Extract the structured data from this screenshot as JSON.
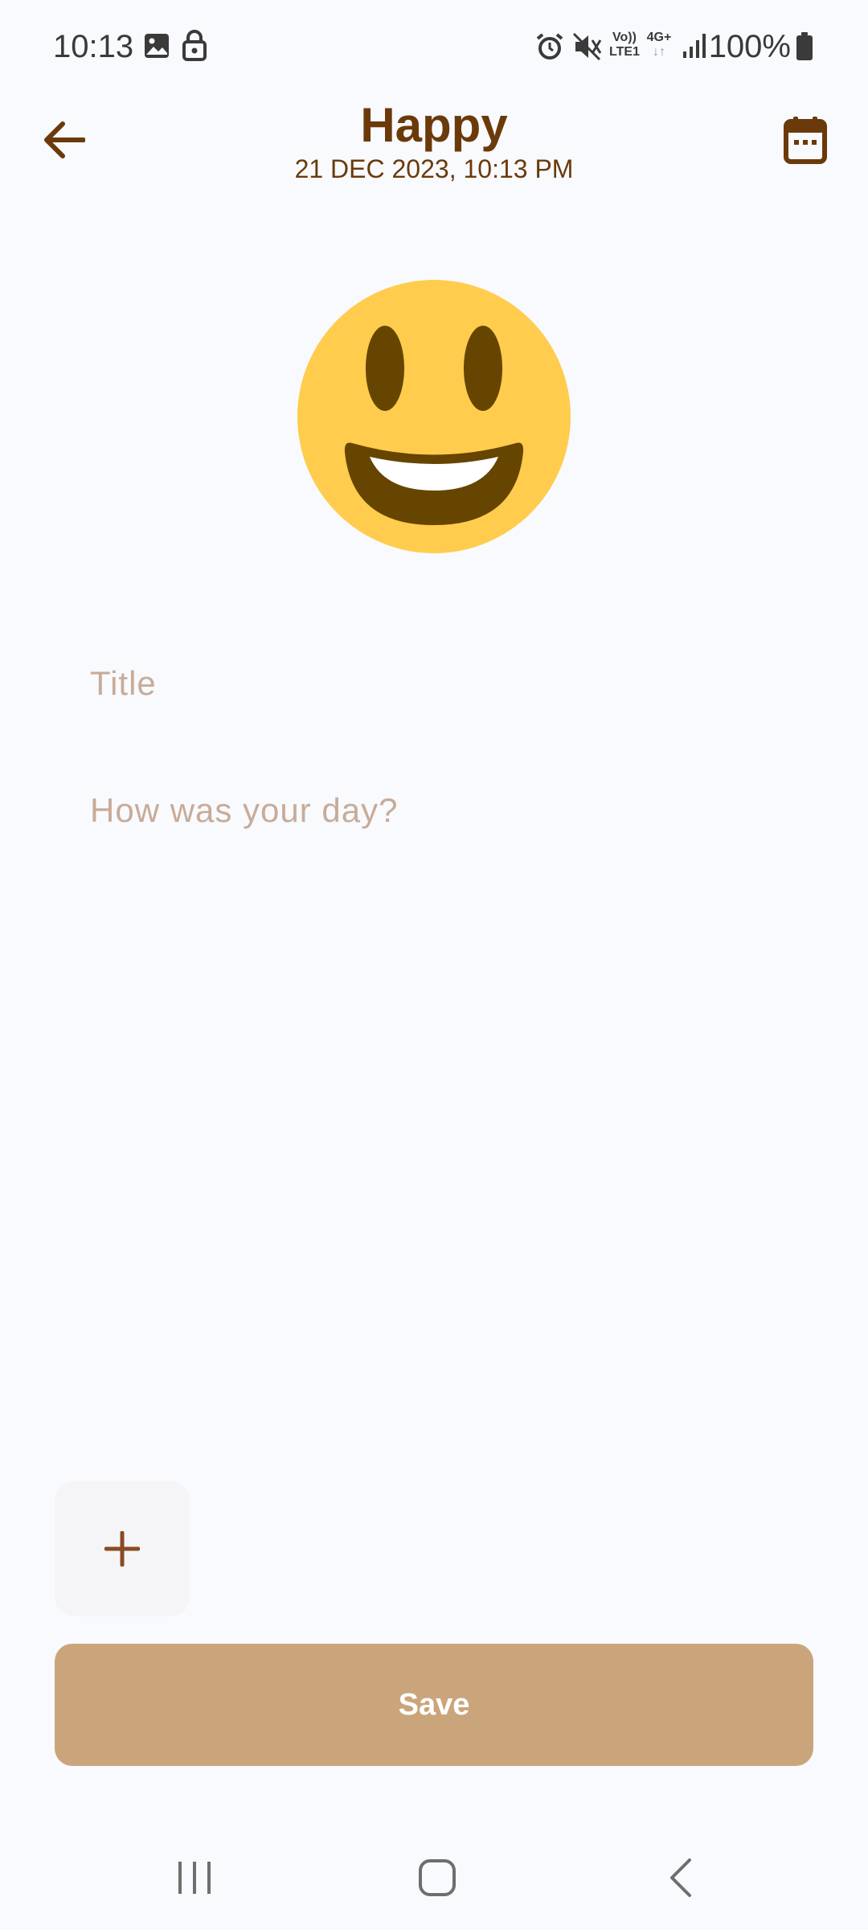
{
  "status_bar": {
    "time": "10:13",
    "battery": "100%",
    "network_volte": "Vo))",
    "network_lte": "LTE1",
    "network_type": "4G+"
  },
  "header": {
    "title": "Happy",
    "date": "21 DEC 2023, 10:13 PM"
  },
  "mood": {
    "icon": "happy-face-icon"
  },
  "form": {
    "title_placeholder": "Title",
    "title_value": "",
    "body_placeholder": "How was your day?",
    "body_value": ""
  },
  "actions": {
    "add_icon": "plus-icon",
    "save_label": "Save"
  },
  "colors": {
    "background": "#f8fafe",
    "accent_brown": "#6b3a0a",
    "save_button": "#caa57b",
    "placeholder": "#c8ab98",
    "emoji_face": "#ffcc4d",
    "emoji_feature": "#664500"
  }
}
